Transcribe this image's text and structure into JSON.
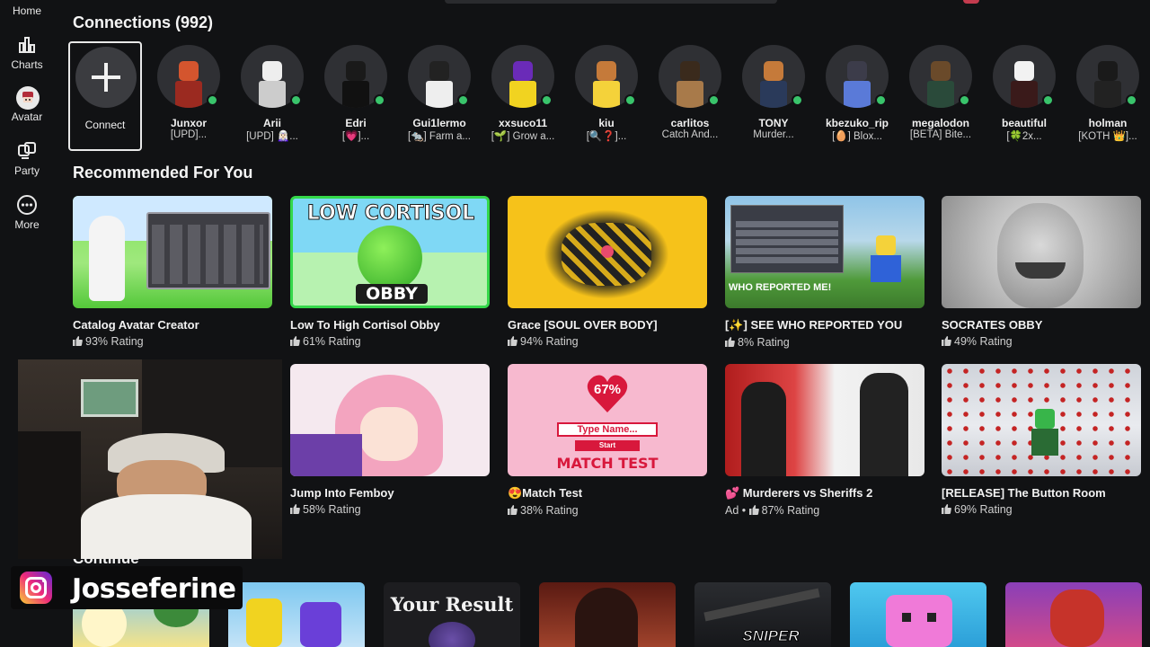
{
  "sidebar": {
    "items": [
      {
        "label": "Home",
        "icon": "home-icon"
      },
      {
        "label": "Charts",
        "icon": "charts-icon"
      },
      {
        "label": "Avatar",
        "icon": "avatar-icon"
      },
      {
        "label": "Party",
        "icon": "party-icon"
      },
      {
        "label": "More",
        "icon": "more-icon"
      }
    ]
  },
  "connections": {
    "title": "Connections (992)",
    "connect_label": "Connect",
    "friends": [
      {
        "name": "Junxor",
        "status": "[UPD]..."
      },
      {
        "name": "Arii",
        "status": "[UPD] 🧝🏻‍♀️..."
      },
      {
        "name": "Edri",
        "status": "[💗]..."
      },
      {
        "name": "Gui1lermo",
        "status": "[🐀] Farm a..."
      },
      {
        "name": "xxsuco11",
        "status": "[🌱] Grow a..."
      },
      {
        "name": "kiu",
        "status": "[🔍❓]..."
      },
      {
        "name": "carlitos",
        "status": "Catch And..."
      },
      {
        "name": "TONY",
        "status": "Murder..."
      },
      {
        "name": "kbezuko_rip",
        "status": "[🥚] Blox..."
      },
      {
        "name": "megalodon",
        "status": "[BETA] Bite..."
      },
      {
        "name": "beautiful",
        "status": "[🍀2x..."
      },
      {
        "name": "holman",
        "status": "[KOTH 👑]..."
      }
    ]
  },
  "recommended": {
    "title": "Recommended For You",
    "games": [
      {
        "title": "Catalog Avatar Creator",
        "rating": "93% Rating"
      },
      {
        "title": "Low To High Cortisol Obby",
        "rating": "61% Rating",
        "thumb_text_top": "LOW CORTISOL",
        "thumb_text_bottom": "OBBY"
      },
      {
        "title": "Grace [SOUL OVER BODY]",
        "rating": "94% Rating"
      },
      {
        "title": "[✨] SEE WHO REPORTED YOU",
        "rating": "8% Rating",
        "thumb_text": "WHO REPORTED ME!"
      },
      {
        "title": "SOCRATES OBBY",
        "rating": "49% Rating"
      },
      {
        "title": "Jump Into Femboy",
        "rating": "58% Rating"
      },
      {
        "title": "😍Match Test",
        "rating": "38% Rating",
        "thumb_pct": "67%",
        "thumb_input": "Type Name...",
        "thumb_btn": "Start",
        "thumb_text": "MATCH TEST"
      },
      {
        "title": "💕 Murderers vs Sheriffs 2",
        "rating": "87% Rating",
        "prefix": "Ad • "
      },
      {
        "title": "[RELEASE] The Button Room",
        "rating": "69% Rating"
      }
    ]
  },
  "continue": {
    "title": "Continue",
    "tiles": [
      {
        "text": ""
      },
      {
        "text": ""
      },
      {
        "text": "Your Result"
      },
      {
        "text": ""
      },
      {
        "text": "SNIPER"
      },
      {
        "text": ""
      },
      {
        "text": ""
      }
    ]
  },
  "streamer": {
    "name": "Josseferine"
  },
  "colors": {
    "background": "#111214",
    "online": "#39c46b",
    "card_text": "#f2f2f2"
  }
}
